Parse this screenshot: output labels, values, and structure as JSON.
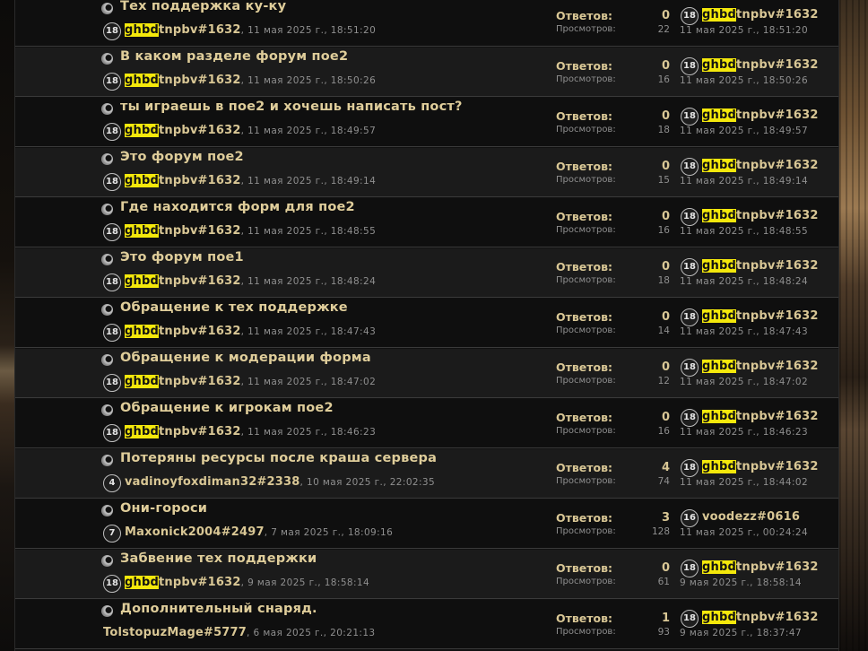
{
  "labels": {
    "answers": "Ответов:",
    "views": "Просмотров:"
  },
  "colors": {
    "highlight": "#f4e80b",
    "title": "#dfcd9a",
    "meta": "#8f8f8f"
  },
  "topics": [
    {
      "title": "Тех поддержка ку-ку",
      "avatar_badge": "18",
      "author_hl": "ghbd",
      "author_rest": "tnpbv#1632",
      "date": ", 11 мая 2025 г., 18:51:20",
      "replies": "0",
      "views": "22",
      "last_badge": "18",
      "last_hl": "ghbd",
      "last_rest": "tnpbv#1632",
      "last_date": "11 мая 2025 г., 18:51:20"
    },
    {
      "title": "В каком разделе форум пое2",
      "avatar_badge": "18",
      "author_hl": "ghbd",
      "author_rest": "tnpbv#1632",
      "date": ", 11 мая 2025 г., 18:50:26",
      "replies": "0",
      "views": "16",
      "last_badge": "18",
      "last_hl": "ghbd",
      "last_rest": "tnpbv#1632",
      "last_date": "11 мая 2025 г., 18:50:26"
    },
    {
      "title": "ты играешь в пое2 и хочешь написать пост?",
      "avatar_badge": "18",
      "author_hl": "ghbd",
      "author_rest": "tnpbv#1632",
      "date": ", 11 мая 2025 г., 18:49:57",
      "replies": "0",
      "views": "18",
      "last_badge": "18",
      "last_hl": "ghbd",
      "last_rest": "tnpbv#1632",
      "last_date": "11 мая 2025 г., 18:49:57"
    },
    {
      "title": "Это форум пое2",
      "avatar_badge": "18",
      "author_hl": "ghbd",
      "author_rest": "tnpbv#1632",
      "date": ", 11 мая 2025 г., 18:49:14",
      "replies": "0",
      "views": "15",
      "last_badge": "18",
      "last_hl": "ghbd",
      "last_rest": "tnpbv#1632",
      "last_date": "11 мая 2025 г., 18:49:14"
    },
    {
      "title": "Где находится форм для пое2",
      "avatar_badge": "18",
      "author_hl": "ghbd",
      "author_rest": "tnpbv#1632",
      "date": ", 11 мая 2025 г., 18:48:55",
      "replies": "0",
      "views": "16",
      "last_badge": "18",
      "last_hl": "ghbd",
      "last_rest": "tnpbv#1632",
      "last_date": "11 мая 2025 г., 18:48:55"
    },
    {
      "title": "Это форум пое1",
      "avatar_badge": "18",
      "author_hl": "ghbd",
      "author_rest": "tnpbv#1632",
      "date": ", 11 мая 2025 г., 18:48:24",
      "replies": "0",
      "views": "18",
      "last_badge": "18",
      "last_hl": "ghbd",
      "last_rest": "tnpbv#1632",
      "last_date": "11 мая 2025 г., 18:48:24"
    },
    {
      "title": "Обращение к тех поддержке",
      "avatar_badge": "18",
      "author_hl": "ghbd",
      "author_rest": "tnpbv#1632",
      "date": ", 11 мая 2025 г., 18:47:43",
      "replies": "0",
      "views": "14",
      "last_badge": "18",
      "last_hl": "ghbd",
      "last_rest": "tnpbv#1632",
      "last_date": "11 мая 2025 г., 18:47:43"
    },
    {
      "title": "Обращение к модерации форма",
      "avatar_badge": "18",
      "author_hl": "ghbd",
      "author_rest": "tnpbv#1632",
      "date": ", 11 мая 2025 г., 18:47:02",
      "replies": "0",
      "views": "12",
      "last_badge": "18",
      "last_hl": "ghbd",
      "last_rest": "tnpbv#1632",
      "last_date": "11 мая 2025 г., 18:47:02"
    },
    {
      "title": "Обращение к игрокам пое2",
      "avatar_badge": "18",
      "author_hl": "ghbd",
      "author_rest": "tnpbv#1632",
      "date": ", 11 мая 2025 г., 18:46:23",
      "replies": "0",
      "views": "16",
      "last_badge": "18",
      "last_hl": "ghbd",
      "last_rest": "tnpbv#1632",
      "last_date": "11 мая 2025 г., 18:46:23"
    },
    {
      "title": "Потеряны ресурсы после краша сервера",
      "avatar_badge": "4",
      "author_hl": "",
      "author_rest": "vadinoyfoxdiman32#2338",
      "date": ", 10 мая 2025 г., 22:02:35",
      "replies": "4",
      "views": "74",
      "last_badge": "18",
      "last_hl": "ghbd",
      "last_rest": "tnpbv#1632",
      "last_date": "11 мая 2025 г., 18:44:02"
    },
    {
      "title": "Они-гороси",
      "avatar_badge": "7",
      "author_hl": "",
      "author_rest": "Maxonick2004#2497",
      "date": ", 7 мая 2025 г., 18:09:16",
      "replies": "3",
      "views": "128",
      "last_badge": "16",
      "last_hl": "",
      "last_rest": "voodezz#0616",
      "last_date": "11 мая 2025 г., 00:24:24"
    },
    {
      "title": "Забвение тех поддержки",
      "avatar_badge": "18",
      "author_hl": "ghbd",
      "author_rest": "tnpbv#1632",
      "date": ", 9 мая 2025 г., 18:58:14",
      "replies": "0",
      "views": "61",
      "last_badge": "18",
      "last_hl": "ghbd",
      "last_rest": "tnpbv#1632",
      "last_date": "9 мая 2025 г., 18:58:14"
    },
    {
      "title": "Дополнительный снаряд.",
      "avatar_badge": "",
      "author_hl": "",
      "author_rest": "TolstopuzMage#5777",
      "date": ", 6 мая 2025 г., 20:21:13",
      "replies": "1",
      "views": "93",
      "last_badge": "18",
      "last_hl": "ghbd",
      "last_rest": "tnpbv#1632",
      "last_date": "9 мая 2025 г., 18:37:47"
    }
  ]
}
